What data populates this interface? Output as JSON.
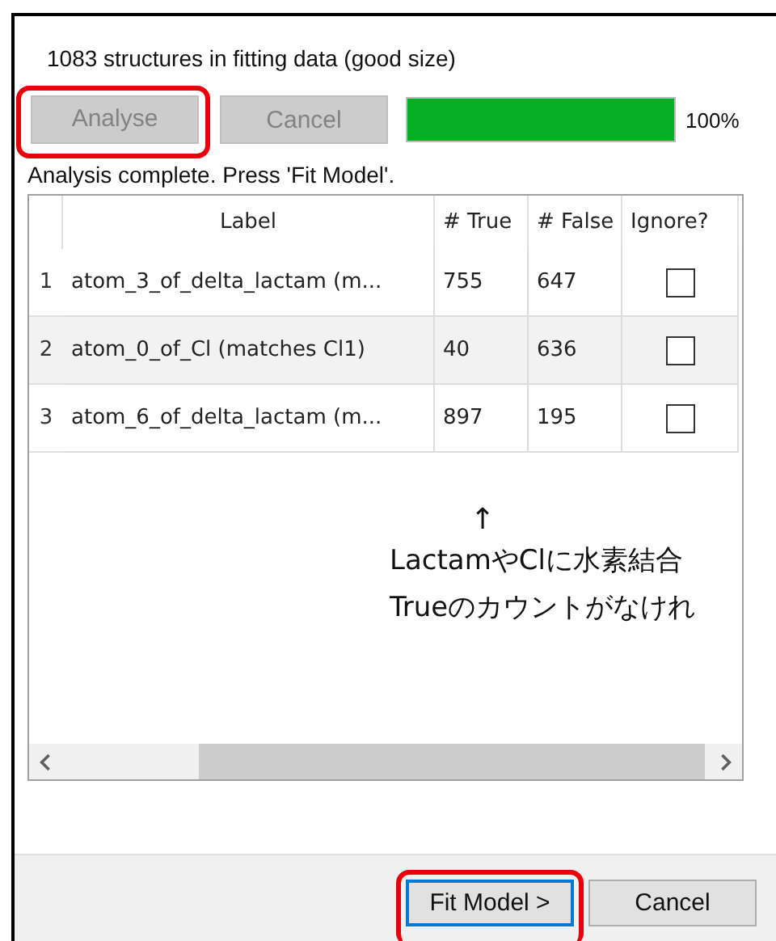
{
  "info": "1083 structures in fitting data (good size)",
  "toolbar": {
    "buttons": [
      {
        "label": "Analyse",
        "disabled": true,
        "highlighted": true
      },
      {
        "label": "Cancel",
        "disabled": true,
        "highlighted": false
      }
    ],
    "progress": {
      "level": 1.0,
      "reading": "100%"
    }
  },
  "status": "Analysis complete. Press 'Fit Model'.",
  "table": {
    "columns": [
      "Label",
      "# True",
      "# False",
      "Ignore?"
    ],
    "rows": [
      {
        "number": "1",
        "label": "atom_3_of_delta_lactam (m...",
        "true": "755",
        "false": "647",
        "ignore": false
      },
      {
        "number": "2",
        "label": "atom_0_of_Cl (matches Cl1)",
        "true": "40",
        "false": "636",
        "ignore": false
      },
      {
        "number": "3",
        "label": "atom_6_of_delta_lactam (m...",
        "true": "897",
        "false": "195",
        "ignore": false
      }
    ]
  },
  "note": {
    "arrow": "↑",
    "lines": [
      "LactamやClに水素結合",
      "Trueのカウントがなけれ"
    ]
  },
  "footer": {
    "buttons": [
      {
        "label": "Fit Model >",
        "default": true,
        "highlighted": true
      },
      {
        "label": "Cancel",
        "default": false,
        "highlighted": false
      }
    ]
  }
}
